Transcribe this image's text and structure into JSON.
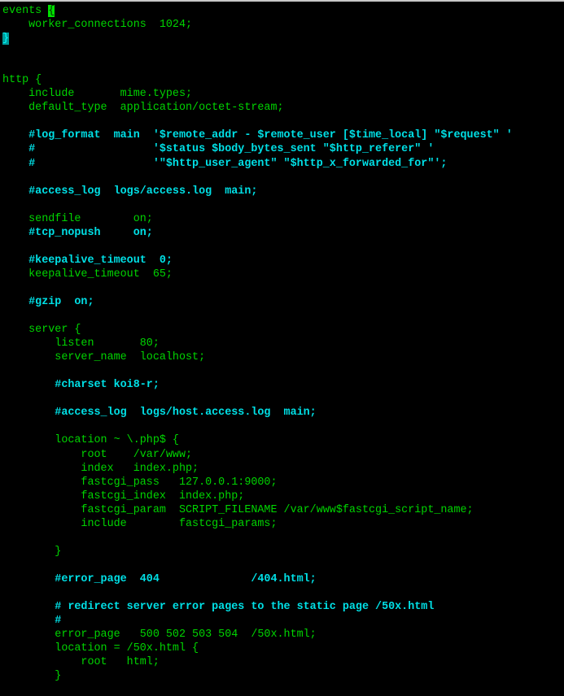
{
  "colors": {
    "text": "#00d400",
    "comment": "#00e0e6",
    "background": "#000000",
    "cursor": "#00e000",
    "match_bracket": "#009a9a"
  },
  "lines": [
    {
      "pre": "events ",
      "hl": "{",
      "hl_kind": "cursor",
      "post": ""
    },
    {
      "text": "    worker_connections  1024;"
    },
    {
      "pre": "",
      "hl": "}",
      "hl_kind": "match",
      "post": ""
    },
    {
      "text": ""
    },
    {
      "text": ""
    },
    {
      "text": "http {"
    },
    {
      "text": "    include       mime.types;"
    },
    {
      "text": "    default_type  application/octet-stream;"
    },
    {
      "text": ""
    },
    {
      "text": "    #log_format  main  '$remote_addr - $remote_user [$time_local] \"$request\" '",
      "kind": "comment"
    },
    {
      "text": "    #                  '$status $body_bytes_sent \"$http_referer\" '",
      "kind": "comment"
    },
    {
      "text": "    #                  '\"$http_user_agent\" \"$http_x_forwarded_for\"';",
      "kind": "comment"
    },
    {
      "text": ""
    },
    {
      "text": "    #access_log  logs/access.log  main;",
      "kind": "comment"
    },
    {
      "text": ""
    },
    {
      "text": "    sendfile        on;"
    },
    {
      "text": "    #tcp_nopush     on;",
      "kind": "comment"
    },
    {
      "text": ""
    },
    {
      "text": "    #keepalive_timeout  0;",
      "kind": "comment"
    },
    {
      "text": "    keepalive_timeout  65;"
    },
    {
      "text": ""
    },
    {
      "text": "    #gzip  on;",
      "kind": "comment"
    },
    {
      "text": ""
    },
    {
      "text": "    server {"
    },
    {
      "text": "        listen       80;"
    },
    {
      "text": "        server_name  localhost;"
    },
    {
      "text": ""
    },
    {
      "text": "        #charset koi8-r;",
      "kind": "comment"
    },
    {
      "text": ""
    },
    {
      "text": "        #access_log  logs/host.access.log  main;",
      "kind": "comment"
    },
    {
      "text": ""
    },
    {
      "text": "        location ~ \\.php$ {"
    },
    {
      "text": "            root    /var/www;"
    },
    {
      "text": "            index   index.php;"
    },
    {
      "text": "            fastcgi_pass   127.0.0.1:9000;"
    },
    {
      "text": "            fastcgi_index  index.php;"
    },
    {
      "text": "            fastcgi_param  SCRIPT_FILENAME /var/www$fastcgi_script_name;"
    },
    {
      "text": "            include        fastcgi_params;"
    },
    {
      "text": ""
    },
    {
      "text": "        }"
    },
    {
      "text": ""
    },
    {
      "text": "        #error_page  404              /404.html;",
      "kind": "comment"
    },
    {
      "text": ""
    },
    {
      "text": "        # redirect server error pages to the static page /50x.html",
      "kind": "comment"
    },
    {
      "text": "        #",
      "kind": "comment"
    },
    {
      "text": "        error_page   500 502 503 504  /50x.html;"
    },
    {
      "text": "        location = /50x.html {"
    },
    {
      "text": "            root   html;"
    },
    {
      "text": "        }"
    }
  ]
}
